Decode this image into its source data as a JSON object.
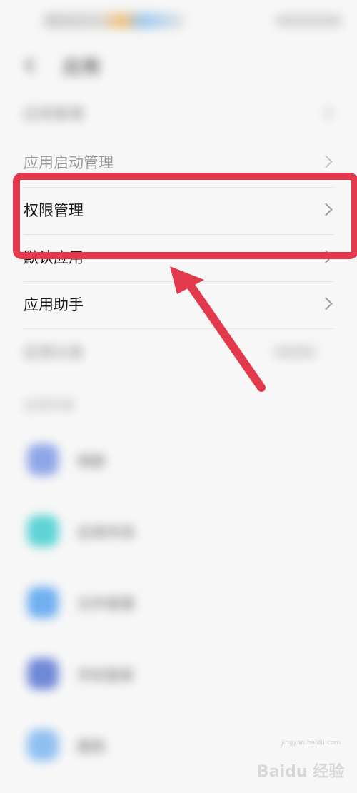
{
  "status_bar": {
    "time": "",
    "battery": ""
  },
  "header": {
    "title": "应用"
  },
  "settings": {
    "items": [
      {
        "label": "应用管理"
      },
      {
        "label": "应用启动管理"
      },
      {
        "label": "权限管理"
      },
      {
        "label": "默认应用"
      },
      {
        "label": "应用助手"
      },
      {
        "label": "应用分身"
      }
    ]
  },
  "apps_section": {
    "title": "应用列表",
    "apps": [
      {
        "name": "相册",
        "color": "#8fa6e8"
      },
      {
        "name": "应用市场",
        "color": "#5cd3d6"
      },
      {
        "name": "文件管理",
        "color": "#6fb0f0"
      },
      {
        "name": "手机管家",
        "color": "#6f88d8"
      },
      {
        "name": "图库",
        "color": "#8fc0f2"
      }
    ]
  },
  "overlay": {
    "highlight_color": "#e23a4c",
    "arrow_color": "#e23a4c"
  },
  "watermark": {
    "brand": "Baidu 经验",
    "url": "jingyan.baidu.com"
  }
}
